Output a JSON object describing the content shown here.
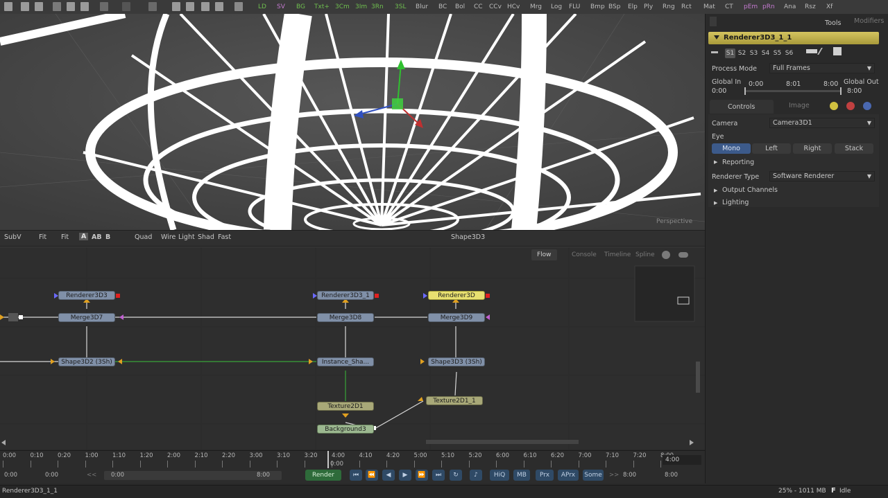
{
  "toolbar": {
    "tools": [
      "LD",
      "SV",
      "BG",
      "Txt+",
      "3Cm",
      "3Im",
      "3Rn",
      "3SL",
      "Blur",
      "BC",
      "Bol",
      "CC",
      "CCv",
      "HCv",
      "Mrg",
      "Log",
      "FLU",
      "Bmp",
      "BSp",
      "Elp",
      "Ply",
      "Rng",
      "Rct",
      "Mat",
      "CT",
      "pEm",
      "pRn",
      "Ana",
      "Rsz",
      "Xf"
    ]
  },
  "viewer": {
    "overlay_label": "Perspective",
    "bar": {
      "subv": "SubV",
      "fit": "Fit",
      "fit2": "Fit",
      "a_btn": "A",
      "ab_btn": "AB",
      "b_btn": "B",
      "quad": "Quad",
      "wire": "Wire",
      "light": "Light",
      "shad": "Shad",
      "fast": "Fast",
      "title": "Shape3D3"
    }
  },
  "flow": {
    "tabs": {
      "flow": "Flow",
      "console": "Console",
      "timeline": "Timeline",
      "spline": "Spline"
    },
    "nodes": {
      "renderer1": "Renderer3D3",
      "renderer2": "Renderer3D3_1",
      "renderer3": "Renderer3D",
      "merge1": "Merge3D7",
      "merge2": "Merge3D8",
      "merge3": "Merge3D9",
      "shape2": "Shape3D2 (3Sh)",
      "instance": "Instance_Sha...",
      "shape3": "Shape3D3 (3Sh)",
      "texture1": "Texture2D1",
      "texture2": "Texture2D1_1",
      "background": "Background3"
    }
  },
  "timeline": {
    "ticks": [
      "0:00",
      "0:10",
      "0:20",
      "1:00",
      "1:10",
      "1:20",
      "2:00",
      "2:10",
      "2:20",
      "3:00",
      "3:10",
      "3:20",
      "4:00",
      "4:10",
      "4:20",
      "5:00",
      "5:10",
      "5:20",
      "6:00",
      "6:10",
      "6:20",
      "7:00",
      "7:10",
      "7:20",
      "8:00"
    ],
    "end_time": "4:00",
    "playhead_time": "0:00",
    "global_start": "0:00",
    "render_start": "0:00",
    "range_start": "0:00",
    "range_end": "8:00",
    "render_end": "8:00",
    "global_end": "8:00",
    "render_label": "Render",
    "hiq": "HiQ",
    "mb": "MB",
    "prx": "Prx",
    "aprx": "APrx",
    "some": "Some"
  },
  "panel": {
    "tabs": {
      "tools": "Tools",
      "modifiers": "Modifiers"
    },
    "tool_name": "Renderer3D3_1_1",
    "slots": [
      "S1",
      "S2",
      "S3",
      "S4",
      "S5",
      "S6"
    ],
    "process_mode_label": "Process Mode",
    "process_mode_value": "Full Frames",
    "global_in_label": "Global In",
    "global_in_value": "0:00",
    "range_a": "0:00",
    "range_mid": "8:01",
    "range_b": "8:00",
    "global_out_label": "Global Out",
    "global_out_value": "8:00",
    "subtabs": {
      "controls": "Controls",
      "image": "Image"
    },
    "camera_label": "Camera",
    "camera_value": "Camera3D1",
    "eye_label": "Eye",
    "eye_options": [
      "Mono",
      "Left",
      "Right",
      "Stack"
    ],
    "reporting": "Reporting",
    "renderer_type_label": "Renderer Type",
    "renderer_type_value": "Software Renderer",
    "output_channels": "Output Channels",
    "lighting": "Lighting"
  },
  "status": {
    "left": "Renderer3D3_1_1",
    "memory": "25% - 1011 MB",
    "state_icon": "F",
    "state": "Idle"
  },
  "colors": {
    "accent_yellow": "#c9b84a",
    "button_blue": "#2f4a66",
    "selected_node": "#e8e070"
  }
}
